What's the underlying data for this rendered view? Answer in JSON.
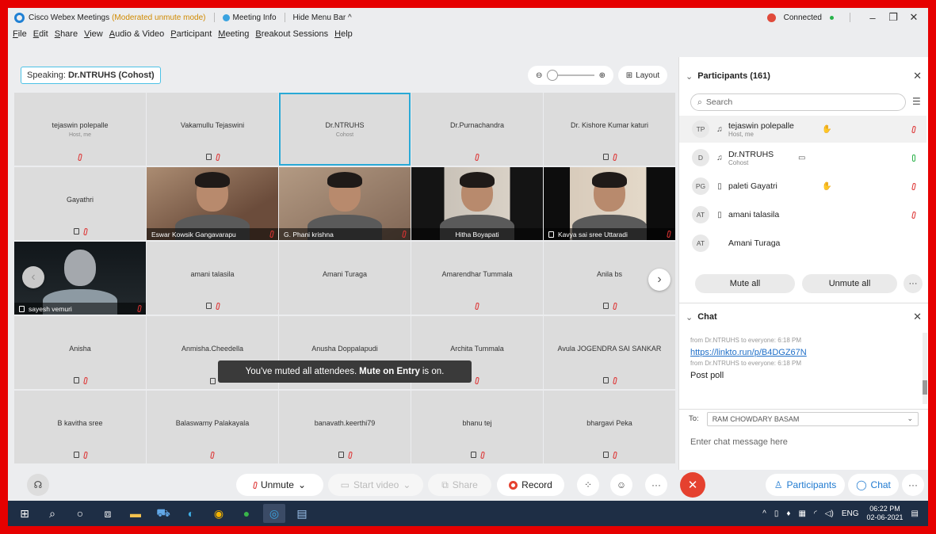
{
  "titlebar": {
    "app_name": "Cisco Webex Meetings",
    "mode": "(Moderated unmute mode)",
    "meeting_info": "Meeting Info",
    "hide_menu": "Hide Menu Bar ^",
    "status": "Connected",
    "status_color": "#27b24a"
  },
  "menu": [
    "File",
    "Edit",
    "Share",
    "View",
    "Audio & Video",
    "Participant",
    "Meeting",
    "Breakout Sessions",
    "Help"
  ],
  "speaking": {
    "label": "Speaking:",
    "name": "Dr.NTRUHS (Cohost)"
  },
  "layout_label": "Layout",
  "tiles": {
    "r0": [
      {
        "name": "tejaswin polepalle",
        "role": "Host, me"
      },
      {
        "name": "Vakamullu Tejaswini"
      },
      {
        "name": "Dr.NTRUHS",
        "role": "Cohost"
      },
      {
        "name": "Dr.Purnachandra"
      },
      {
        "name": "Dr. Kishore Kumar katuri"
      }
    ],
    "gayathri": {
      "name": "Gayathri"
    },
    "videos": [
      {
        "name": "Eswar Kowsik Gangavarapu"
      },
      {
        "name": "G. Phani krishna"
      },
      {
        "name": "Hitha Boyapati"
      },
      {
        "name": "Kavya sai sree Uttaradi"
      },
      {
        "name": "sayesh vemuri"
      }
    ],
    "r2": [
      {
        "name": "amani talasila"
      },
      {
        "name": "Amani Turaga"
      },
      {
        "name": "Amarendhar Tummala"
      },
      {
        "name": "Anila bs"
      }
    ],
    "r3": [
      {
        "name": "Anisha"
      },
      {
        "name": "Anmisha.Cheedella"
      },
      {
        "name": "Anusha Doppalapudi"
      },
      {
        "name": "Archita Tummala"
      },
      {
        "name": "Avula JOGENDRA SAI SANKAR"
      }
    ],
    "r4": [
      {
        "name": "B kavitha sree"
      },
      {
        "name": "Balaswamy Palakayala"
      },
      {
        "name": "banavath.keerthi79"
      },
      {
        "name": "bhanu tej"
      },
      {
        "name": "bhargavi Peka"
      }
    ]
  },
  "toast": {
    "pre": "You've muted all attendees.",
    "bold": "Mute on Entry",
    "post": "is on."
  },
  "toolbar": {
    "unmute": "Unmute",
    "start_video": "Start video",
    "share": "Share",
    "record": "Record",
    "participants": "Participants",
    "chat": "Chat"
  },
  "participants_panel": {
    "title": "Participants (161)",
    "search_placeholder": "Search",
    "rows": [
      {
        "initials": "TP",
        "name": "tejaswin polepalle",
        "sub": "Host, me"
      },
      {
        "initials": "D",
        "name": "Dr.NTRUHS",
        "sub": "Cohost"
      },
      {
        "initials": "PG",
        "name": "paleti Gayatri"
      },
      {
        "initials": "AT",
        "name": "amani talasila"
      },
      {
        "initials": "AT",
        "name": "Amani Turaga"
      }
    ],
    "mute_all": "Mute all",
    "unmute_all": "Unmute all"
  },
  "chat_panel": {
    "title": "Chat",
    "meta1": "from Dr.NTRUHS to everyone:   6:18 PM",
    "link": "https://linkto.run/p/B4DGZ67N",
    "meta2": "from Dr.NTRUHS to everyone:   6:18 PM",
    "message": "Post poll",
    "to_label": "To:",
    "to_value": "RAM CHOWDARY BASAM",
    "input_placeholder": "Enter chat message here"
  },
  "taskbar": {
    "lang": "ENG",
    "time": "06:22 PM",
    "date": "02-06-2021"
  }
}
